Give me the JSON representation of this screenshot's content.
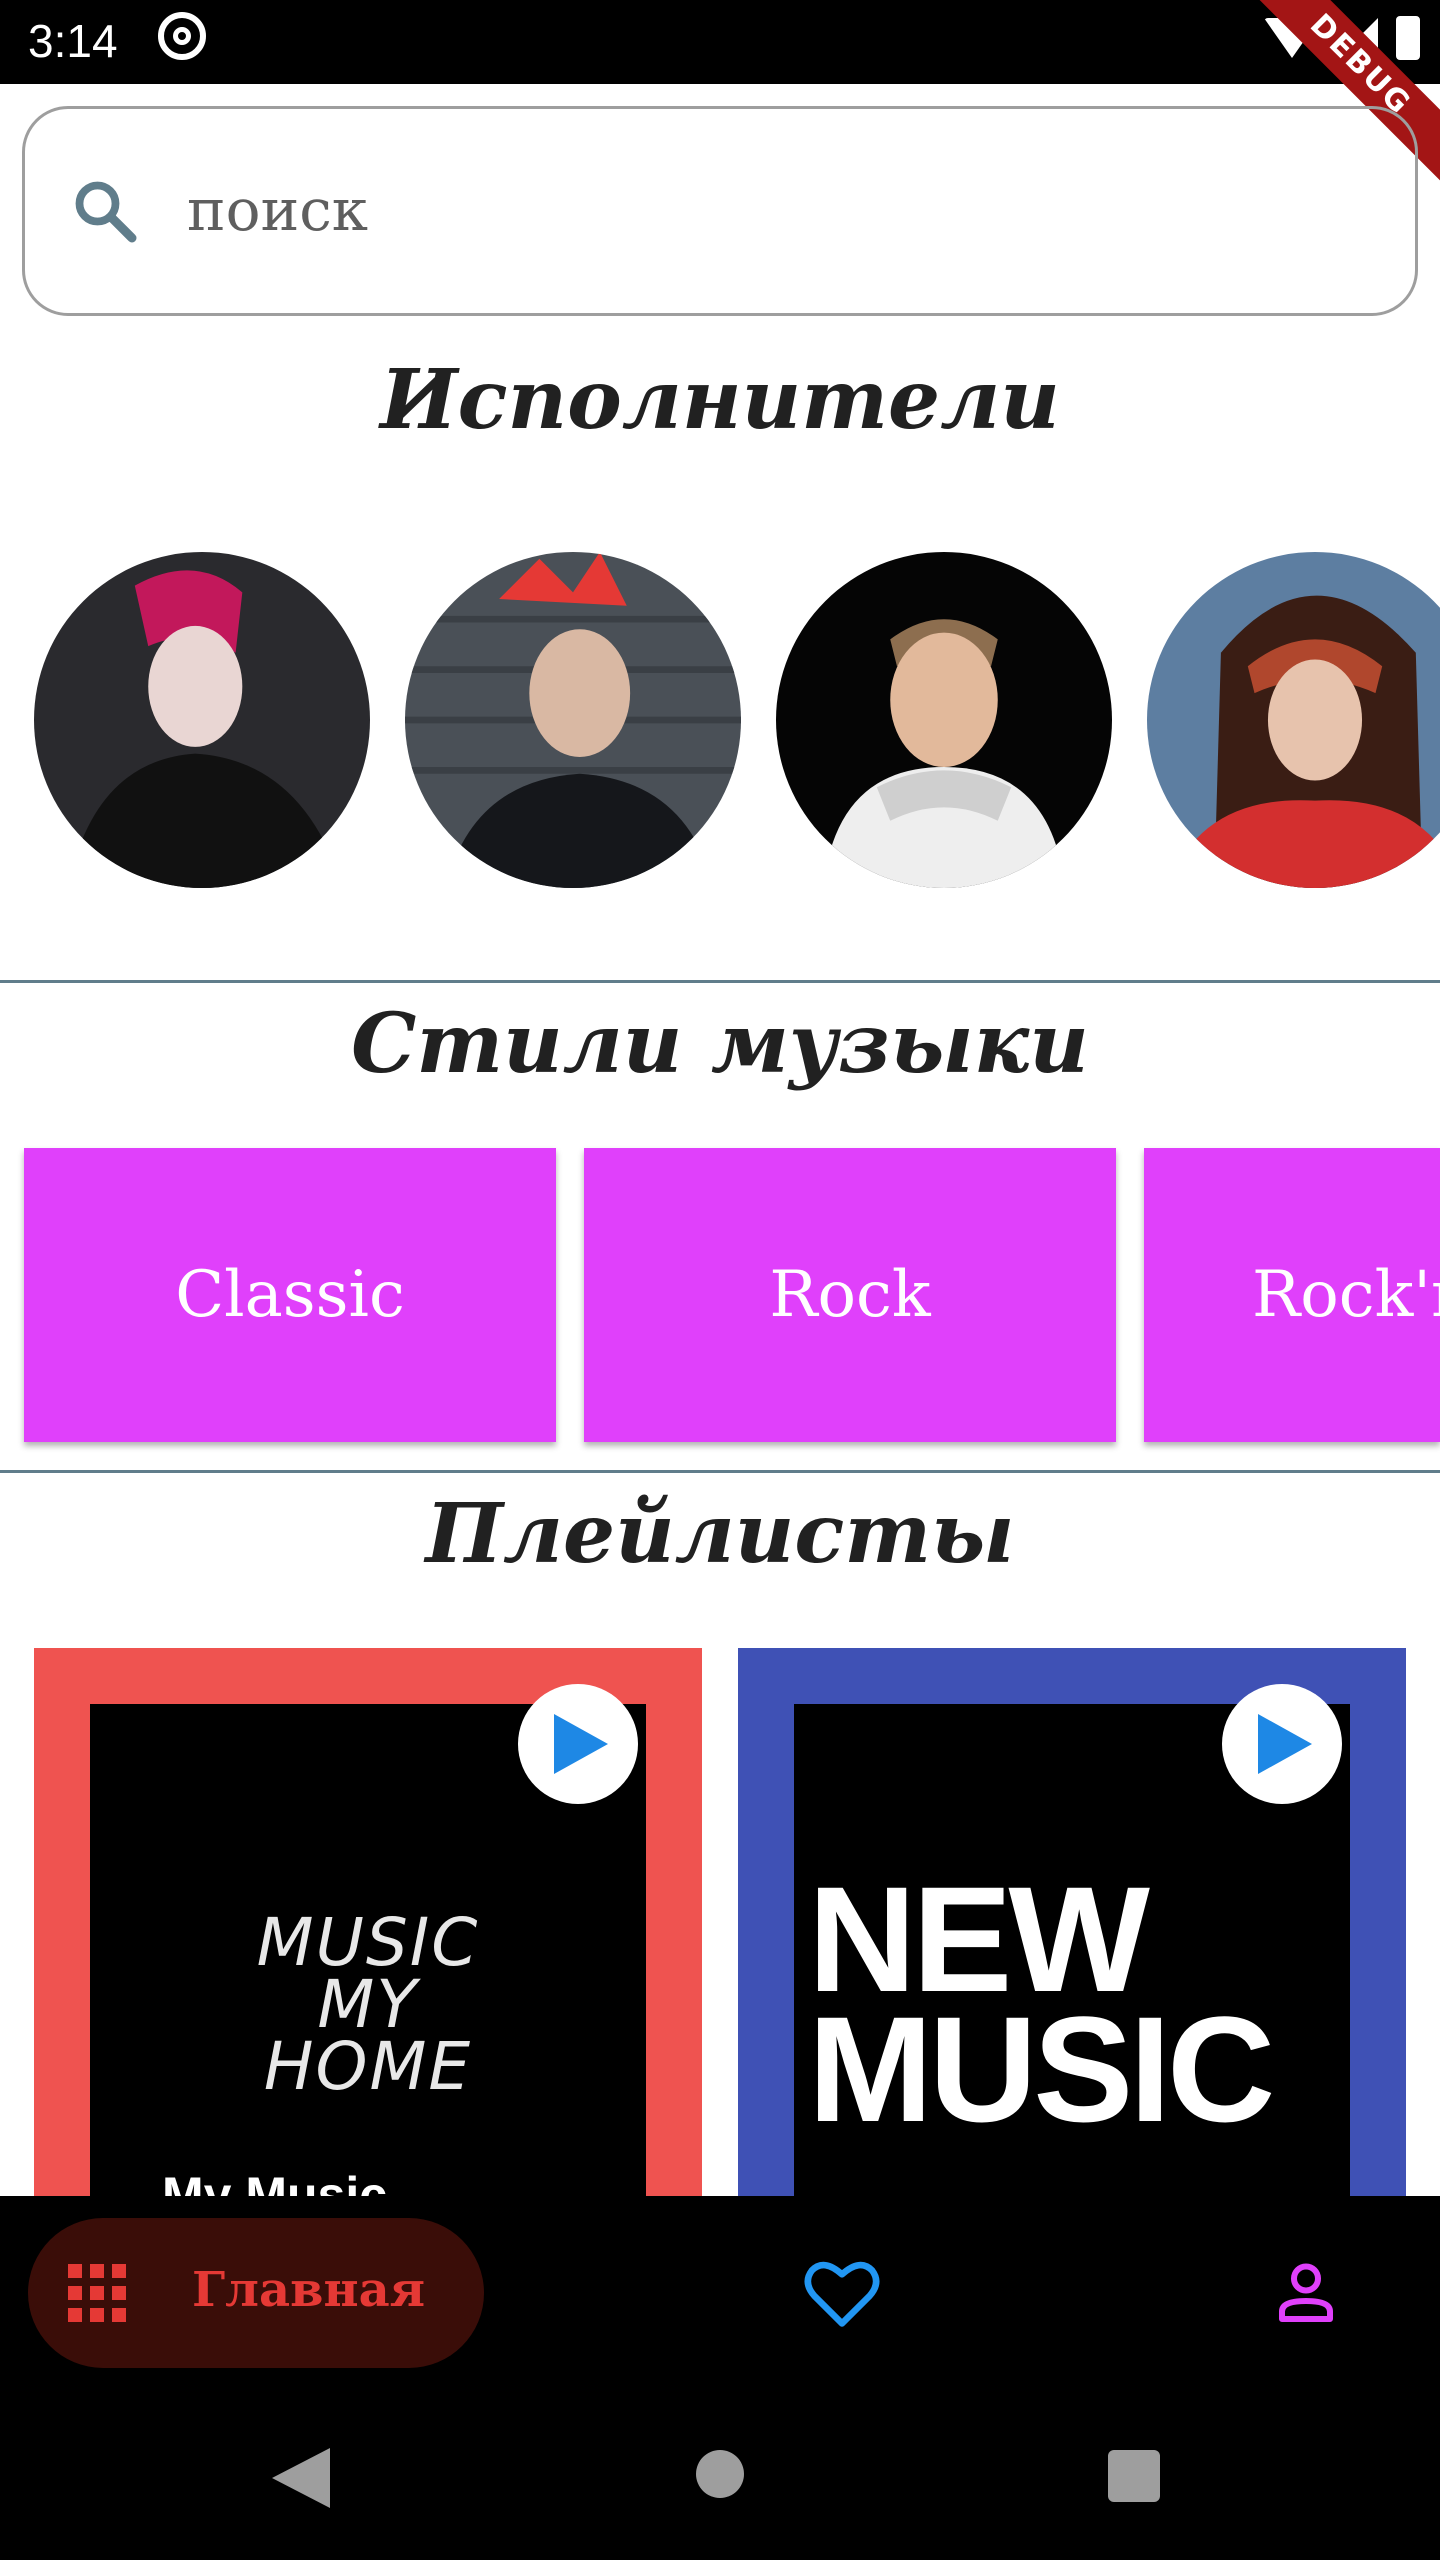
{
  "status_bar": {
    "time": "3:14",
    "debug_label": "DEBUG"
  },
  "search": {
    "placeholder": "поиск"
  },
  "artists_section": {
    "title": "Исполнители",
    "items": [
      {
        "name": "artist-1"
      },
      {
        "name": "artist-2"
      },
      {
        "name": "artist-3"
      },
      {
        "name": "artist-4"
      }
    ]
  },
  "genres_section": {
    "title": "Стили музыки",
    "items": [
      {
        "label": "Classic"
      },
      {
        "label": "Rock"
      },
      {
        "label": "Rock'n'Roll"
      }
    ],
    "card_color": "#e040fb"
  },
  "playlists_section": {
    "title": "Плейлисты",
    "items": [
      {
        "cover_lines": [
          "MUSIC",
          "MY",
          "HOME"
        ],
        "frame_color": "#ef5350",
        "peek_text": "My Music"
      },
      {
        "cover_lines": [
          "NEW",
          "MUSIC"
        ],
        "frame_color": "#3f51b5"
      }
    ]
  },
  "bottom_nav": {
    "home_label": "Главная",
    "home_color": "#e53935",
    "favorites_color": "#2196f3",
    "profile_color": "#e040fb"
  }
}
